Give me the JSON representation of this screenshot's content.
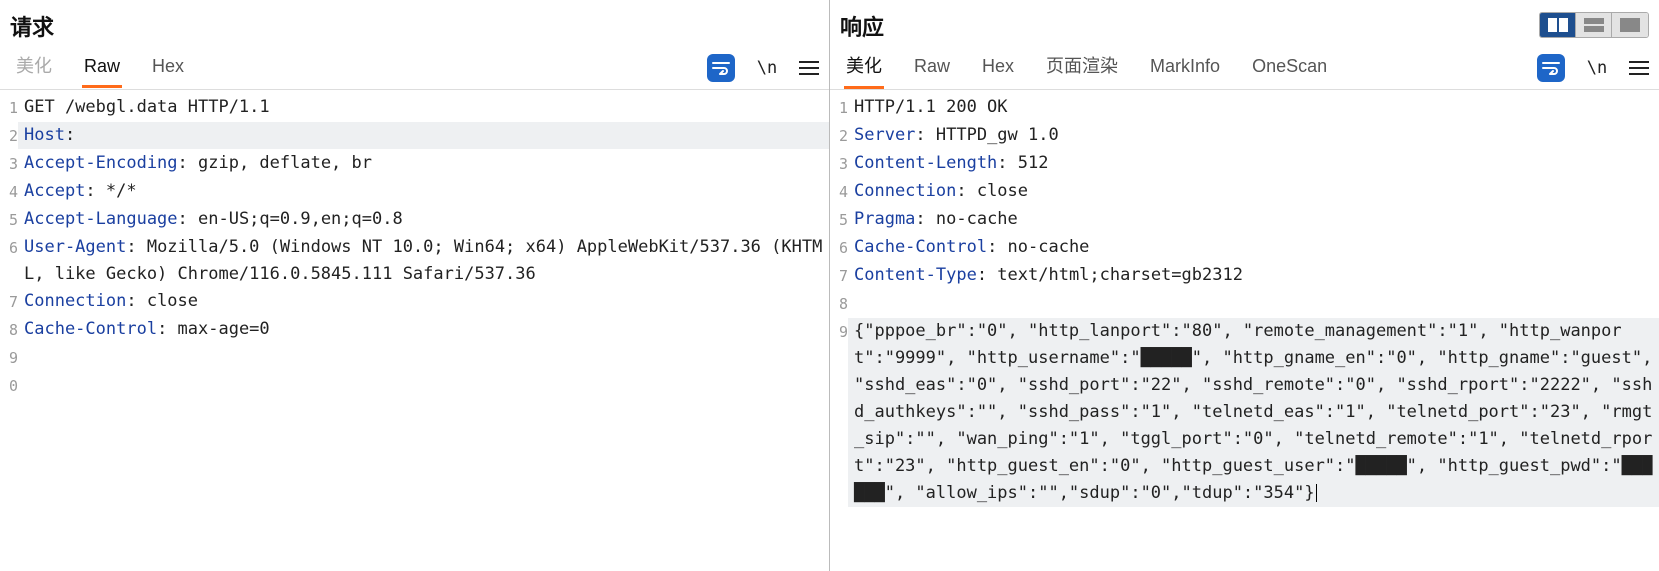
{
  "request": {
    "title": "请求",
    "tabs": [
      {
        "label": "美化",
        "state": "disabled"
      },
      {
        "label": "Raw",
        "state": "active"
      },
      {
        "label": "Hex",
        "state": ""
      }
    ],
    "lines": [
      {
        "n": "1",
        "segs": [
          {
            "t": "GET /webgl.data HTTP/1.1"
          }
        ]
      },
      {
        "n": "2",
        "segs": [
          {
            "t": "Host",
            "c": "hdr"
          },
          {
            "t": ": "
          }
        ],
        "current": true
      },
      {
        "n": "3",
        "segs": [
          {
            "t": "Accept-Encoding",
            "c": "hdr"
          },
          {
            "t": ": gzip, deflate, br"
          }
        ]
      },
      {
        "n": "4",
        "segs": [
          {
            "t": "Accept",
            "c": "hdr"
          },
          {
            "t": ": */*"
          }
        ]
      },
      {
        "n": "5",
        "segs": [
          {
            "t": "Accept-Language",
            "c": "hdr"
          },
          {
            "t": ": en-US;q=0.9,en;q=0.8"
          }
        ]
      },
      {
        "n": "6",
        "segs": [
          {
            "t": "User-Agent",
            "c": "hdr"
          },
          {
            "t": ": Mozilla/5.0 (Windows NT 10.0; Win64; x64) AppleWebKit/537.36 (KHTML, like Gecko) Chrome/116.0.5845.111 Safari/537.36"
          }
        ]
      },
      {
        "n": "7",
        "segs": [
          {
            "t": "Connection",
            "c": "hdr"
          },
          {
            "t": ": close"
          }
        ]
      },
      {
        "n": "8",
        "segs": [
          {
            "t": "Cache-Control",
            "c": "hdr"
          },
          {
            "t": ": max-age=0"
          }
        ]
      },
      {
        "n": "9",
        "segs": []
      },
      {
        "n": "0",
        "segs": []
      }
    ]
  },
  "response": {
    "title": "响应",
    "tabs": [
      {
        "label": "美化",
        "state": "active"
      },
      {
        "label": "Raw",
        "state": ""
      },
      {
        "label": "Hex",
        "state": ""
      },
      {
        "label": "页面渲染",
        "state": ""
      },
      {
        "label": "MarkInfo",
        "state": ""
      },
      {
        "label": "OneScan",
        "state": ""
      }
    ],
    "lines": [
      {
        "n": "1",
        "segs": [
          {
            "t": "HTTP/1.1 200 OK"
          }
        ]
      },
      {
        "n": "2",
        "segs": [
          {
            "t": "Server",
            "c": "hdr"
          },
          {
            "t": ": HTTPD_gw 1.0"
          }
        ]
      },
      {
        "n": "3",
        "segs": [
          {
            "t": "Content-Length",
            "c": "hdr"
          },
          {
            "t": ": 512"
          }
        ]
      },
      {
        "n": "4",
        "segs": [
          {
            "t": "Connection",
            "c": "hdr"
          },
          {
            "t": ": close"
          }
        ]
      },
      {
        "n": "5",
        "segs": [
          {
            "t": "Pragma",
            "c": "hdr"
          },
          {
            "t": ": no-cache"
          }
        ]
      },
      {
        "n": "6",
        "segs": [
          {
            "t": "Cache-Control",
            "c": "hdr"
          },
          {
            "t": ": no-cache"
          }
        ]
      },
      {
        "n": "7",
        "segs": [
          {
            "t": "Content-Type",
            "c": "hdr"
          },
          {
            "t": ": text/html;charset=gb2312"
          }
        ]
      },
      {
        "n": "8",
        "segs": []
      },
      {
        "n": "9",
        "segs": [
          {
            "t": "{\"pppoe_br\":\"0\", \"http_lanport\":\"80\", \"remote_management\":\"1\", \"http_wanport\":\"9999\", \"http_username\":\"█████\", \"http_gname_en\":\"0\", \"http_gname\":\"guest\", \"sshd_eas\":\"0\", \"sshd_port\":\"22\", \"sshd_remote\":\"0\", \"sshd_rport\":\"2222\", \"sshd_authkeys\":\"\", \"sshd_pass\":\"1\", \"telnetd_eas\":\"1\", \"telnetd_port\":\"23\", \"rmgt_sip\":\"\", \"wan_ping\":\"1\", \"tggl_port\":\"0\", \"telnetd_remote\":\"1\", \"telnetd_rport\":\"23\", \"http_guest_en\":\"0\", \"http_guest_user\":\"█████\", \"http_guest_pwd\":\"██████\", \"allow_ips\":\"\",\"sdup\":\"0\",\"tdup\":\"354\"}"
          }
        ],
        "current": true,
        "caret": true
      }
    ]
  },
  "tools": {
    "ln_label": "\\n"
  }
}
